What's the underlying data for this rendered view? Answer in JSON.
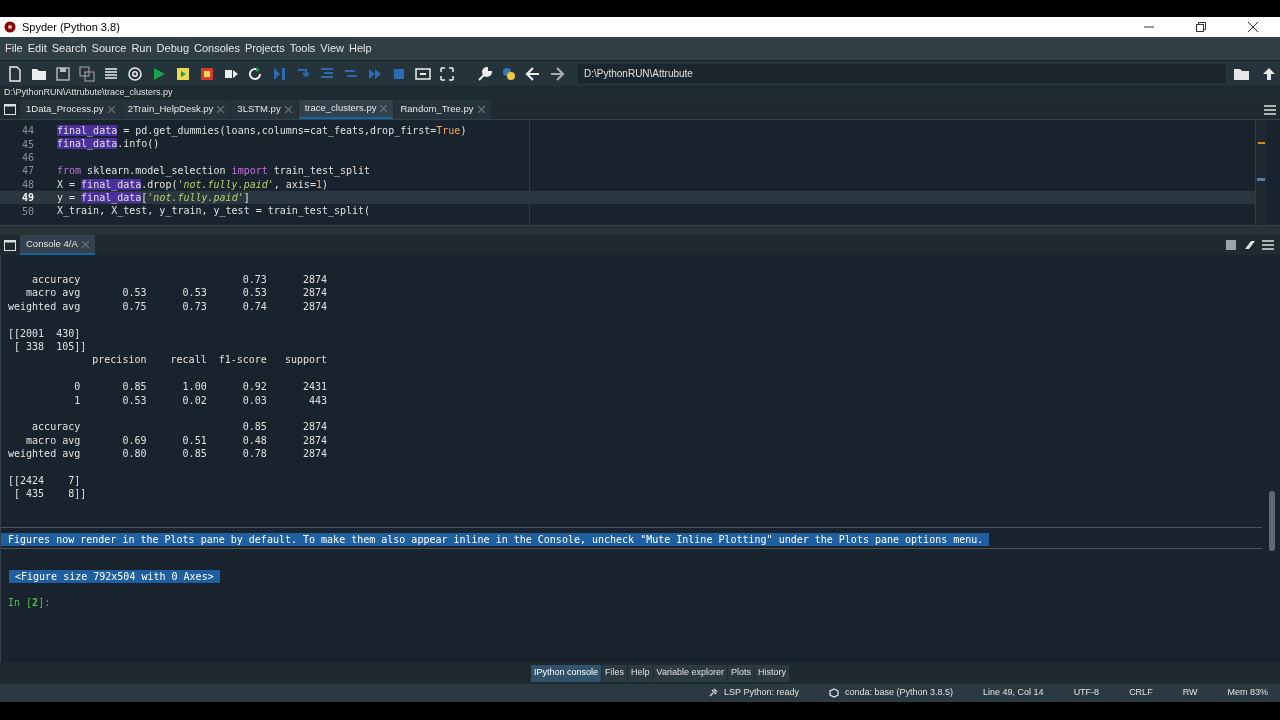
{
  "window": {
    "title": "Spyder (Python 3.8)"
  },
  "menu": [
    "File",
    "Edit",
    "Search",
    "Source",
    "Run",
    "Debug",
    "Consoles",
    "Projects",
    "Tools",
    "View",
    "Help"
  ],
  "toolbar": {
    "path_field": "D:\\PythonRUN\\Attrubute"
  },
  "file_path": "D:\\PythonRUN\\Attrubute\\trace_clusters.py",
  "editor_tabs": [
    {
      "label": "1Data_Process.py",
      "selected": false
    },
    {
      "label": "2Train_HelpDesk.py",
      "selected": false
    },
    {
      "label": "3LSTM.py",
      "selected": false
    },
    {
      "label": "trace_clusters.py",
      "selected": true
    },
    {
      "label": "Random_Tree.py",
      "selected": false
    }
  ],
  "editor": {
    "lines": [
      {
        "number": "44",
        "current": false,
        "segments": [
          {
            "kind": "occurrence",
            "text": "final_data"
          },
          {
            "kind": "plain",
            "text": " = pd.get_dummies(loans,columns=cat_feats,drop_first="
          },
          {
            "kind": "constant",
            "text": "True"
          },
          {
            "kind": "plain",
            "text": ")"
          }
        ]
      },
      {
        "number": "45",
        "current": false,
        "segments": [
          {
            "kind": "occurrence",
            "text": "final_data"
          },
          {
            "kind": "plain",
            "text": ".info()"
          }
        ]
      },
      {
        "number": "46",
        "current": false
      },
      {
        "number": "47",
        "current": false,
        "segments": [
          {
            "kind": "keyword",
            "text": "from"
          },
          {
            "kind": "plain",
            "text": " sklearn.model_selection "
          },
          {
            "kind": "keyword",
            "text": "import"
          },
          {
            "kind": "plain",
            "text": " train_test_split"
          }
        ]
      },
      {
        "number": "48",
        "current": false,
        "segments": [
          {
            "kind": "plain",
            "text": "X = "
          },
          {
            "kind": "occurrence",
            "text": "final_data"
          },
          {
            "kind": "plain",
            "text": ".drop("
          },
          {
            "kind": "string",
            "text": "'not.fully.paid'"
          },
          {
            "kind": "plain",
            "text": ", axis="
          },
          {
            "kind": "constant",
            "text": "1"
          },
          {
            "kind": "plain",
            "text": ")"
          }
        ]
      },
      {
        "number": "49",
        "current": true,
        "segments": [
          {
            "kind": "plain",
            "text": "y = "
          },
          {
            "kind": "occurrence",
            "text": "final_data"
          },
          {
            "kind": "plain",
            "text": "["
          },
          {
            "kind": "string",
            "text": "'not.fully.paid'"
          },
          {
            "kind": "plain",
            "text": "]"
          }
        ]
      },
      {
        "number": "50",
        "current": false,
        "segments": [
          {
            "kind": "plain",
            "text": "X_train, X_test, y_train, y_test = train_test_split("
          }
        ]
      }
    ]
  },
  "console_tabs": [
    {
      "label": "Console 4/A",
      "selected": true
    }
  ],
  "console": {
    "output_blocks": [
      [
        "    accuracy                           0.73      2874",
        "   macro avg       0.53      0.53      0.53      2874",
        "weighted avg       0.75      0.73      0.74      2874"
      ],
      [
        "[[2001  430]",
        " [ 338  105]]",
        "              precision    recall  f1-score   support"
      ],
      [
        "           0       0.85      1.00      0.92      2431",
        "           1       0.53      0.02      0.03       443"
      ],
      [
        "    accuracy                           0.85      2874",
        "   macro avg       0.69      0.51      0.48      2874",
        "weighted avg       0.80      0.85      0.78      2874"
      ],
      [
        "[[2424    7]",
        " [ 435    8]]"
      ]
    ],
    "notice": "Figures now render in the Plots pane by default. To make them also appear inline in the Console, uncheck \"Mute Inline Plotting\" under the Plots pane options menu.",
    "figure_output": "<Figure size 792x504 with 0 Axes>",
    "prompt": "In [**2**]:"
  },
  "pane_tabs": [
    {
      "label": "IPython console",
      "selected": true
    },
    {
      "label": "Files",
      "selected": false
    },
    {
      "label": "Help",
      "selected": false
    },
    {
      "label": "Variable explorer",
      "selected": false
    },
    {
      "label": "Plots",
      "selected": false
    },
    {
      "label": "History",
      "selected": false
    }
  ],
  "status_bar": [
    {
      "kind": "lsp",
      "text": "LSP Python: ready"
    },
    {
      "kind": "conda",
      "text": "conda: base (Python 3.8.5)"
    },
    {
      "kind": "text",
      "text": "Line 49, Col 14"
    },
    {
      "kind": "text",
      "text": "UTF-8"
    },
    {
      "kind": "text",
      "text": "CRLF"
    },
    {
      "kind": "text",
      "text": "RW"
    },
    {
      "kind": "text",
      "text": "Mem 83%"
    }
  ]
}
